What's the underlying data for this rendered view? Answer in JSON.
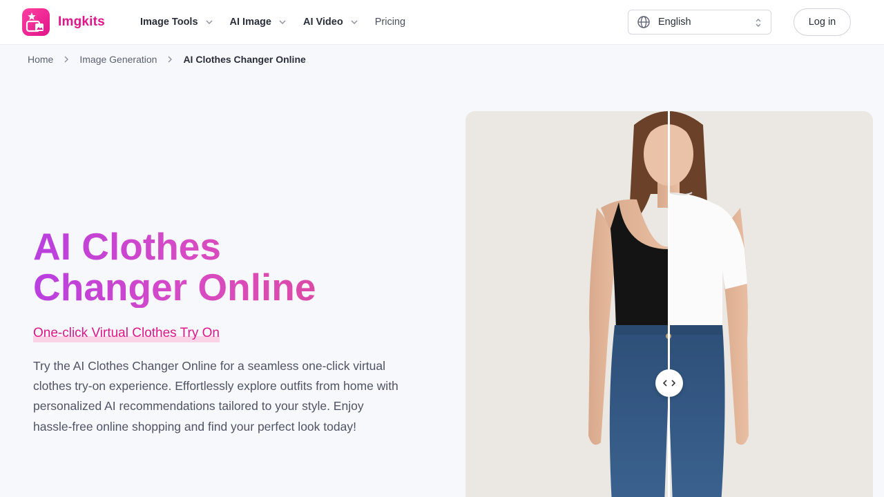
{
  "brand": {
    "name": "Imgkits",
    "accent": "#e0158a"
  },
  "nav": {
    "items": [
      {
        "label": "Image Tools",
        "dropdown": true
      },
      {
        "label": "AI Image",
        "dropdown": true
      },
      {
        "label": "AI Video",
        "dropdown": true
      },
      {
        "label": "Pricing",
        "dropdown": false
      }
    ]
  },
  "language": {
    "selected": "English"
  },
  "auth": {
    "login_label": "Log in"
  },
  "breadcrumb": {
    "items": [
      "Home",
      "Image Generation"
    ],
    "current": "AI Clothes Changer Online"
  },
  "hero": {
    "title_line1": "AI Clothes",
    "title_line2": "Changer Online",
    "subtitle": "One-click Virtual Clothes Try On",
    "description": "Try the AI Clothes Changer Online for a seamless one-click virtual clothes try-on experience. Effortlessly explore outfits from home with personalized AI recommendations tailored to your style. Enjoy hassle-free online shopping and find your perfect look today!"
  },
  "compare": {
    "before": "black tank top",
    "after": "white t-shirt",
    "handle_icons": [
      "chevron-left-icon",
      "chevron-right-icon"
    ]
  }
}
